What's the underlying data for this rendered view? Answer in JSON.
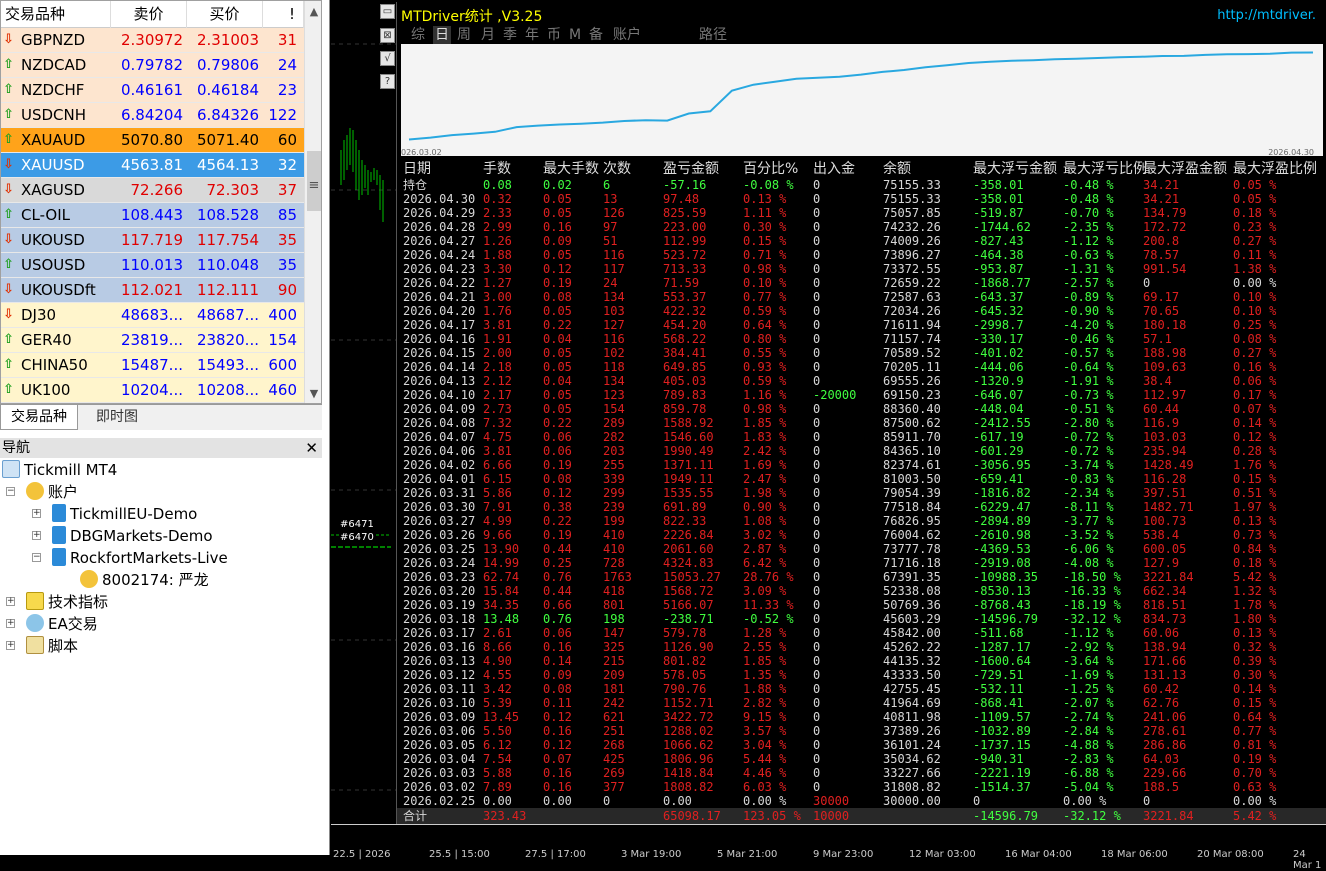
{
  "market_watch": {
    "headers": [
      "交易品种",
      "卖价",
      "买价",
      "!"
    ],
    "rows": [
      {
        "symbol": "GBPNZD",
        "bid": "2.30972",
        "ask": "2.31003",
        "spread": "31",
        "dir": "down",
        "bg": "#fde5cf",
        "color": "#e00000"
      },
      {
        "symbol": "NZDCAD",
        "bid": "0.79782",
        "ask": "0.79806",
        "spread": "24",
        "dir": "up",
        "bg": "#fde5cf",
        "color": "#0000ff"
      },
      {
        "symbol": "NZDCHF",
        "bid": "0.46161",
        "ask": "0.46184",
        "spread": "23",
        "dir": "up",
        "bg": "#fde5cf",
        "color": "#0000ff"
      },
      {
        "symbol": "USDCNH",
        "bid": "6.84204",
        "ask": "6.84326",
        "spread": "122",
        "dir": "up",
        "bg": "#fde5cf",
        "color": "#0000ff"
      },
      {
        "symbol": "XAUAUD",
        "bid": "5070.80",
        "ask": "5071.40",
        "spread": "60",
        "dir": "up",
        "bg": "#ffa31a",
        "color": "#000000"
      },
      {
        "symbol": "XAUUSD",
        "bid": "4563.81",
        "ask": "4564.13",
        "spread": "32",
        "dir": "down",
        "bg": "#3c9be6",
        "color": "#ffffff"
      },
      {
        "symbol": "XAGUSD",
        "bid": "72.266",
        "ask": "72.303",
        "spread": "37",
        "dir": "down",
        "bg": "#d9d9d9",
        "color": "#e00000"
      },
      {
        "symbol": "CL-OIL",
        "bid": "108.443",
        "ask": "108.528",
        "spread": "85",
        "dir": "up",
        "bg": "#b8cbe4",
        "color": "#0000ff"
      },
      {
        "symbol": "UKOUSD",
        "bid": "117.719",
        "ask": "117.754",
        "spread": "35",
        "dir": "down",
        "bg": "#b8cbe4",
        "color": "#e00000"
      },
      {
        "symbol": "USOUSD",
        "bid": "110.013",
        "ask": "110.048",
        "spread": "35",
        "dir": "up",
        "bg": "#b8cbe4",
        "color": "#0000ff"
      },
      {
        "symbol": "UKOUSDft",
        "bid": "112.021",
        "ask": "112.111",
        "spread": "90",
        "dir": "down",
        "bg": "#b8cbe4",
        "color": "#e00000"
      },
      {
        "symbol": "DJ30",
        "bid": "48683...",
        "ask": "48687...",
        "spread": "400",
        "dir": "down",
        "bg": "#fff5cc",
        "color": "#0000ff"
      },
      {
        "symbol": "GER40",
        "bid": "23819...",
        "ask": "23820...",
        "spread": "154",
        "dir": "up",
        "bg": "#fff5cc",
        "color": "#0000ff"
      },
      {
        "symbol": "CHINA50",
        "bid": "15487...",
        "ask": "15493...",
        "spread": "600",
        "dir": "up",
        "bg": "#fff5cc",
        "color": "#0000ff"
      },
      {
        "symbol": "UK100",
        "bid": "10204...",
        "ask": "10208...",
        "spread": "460",
        "dir": "up",
        "bg": "#fff5cc",
        "color": "#0000ff"
      }
    ],
    "tabs": [
      "交易品种",
      "即时图"
    ]
  },
  "navigator": {
    "title": "导航",
    "root": "Tickmill MT4",
    "accounts": "账户",
    "servers": [
      "TickmillEU-Demo",
      "DBGMarkets-Demo",
      "RockfortMarkets-Live"
    ],
    "login": "8002174: 严龙",
    "indicators": "技术指标",
    "ea": "EA交易",
    "scripts": "脚本"
  },
  "stats": {
    "title": "MTDriver统计 ,V3.25",
    "url": "http://mtdriver.",
    "tabs": [
      "综",
      "日",
      "周",
      "月",
      "季",
      "年",
      "币",
      "M",
      "备",
      "账户",
      "",
      "路径"
    ],
    "curve_start": "026.03.02",
    "curve_end": "2026.04.30",
    "headers": [
      "日期",
      "手数",
      "最大手数",
      "次数",
      "盈亏金额",
      "百分比%",
      "出入金",
      "余额",
      "最大浮亏金额",
      "最大浮亏比例",
      "最大浮盈金额",
      "最大浮盈比例"
    ],
    "rows": [
      [
        "持仓",
        "0.08",
        "0.02",
        "6",
        "-57.16",
        "-0.08 %",
        "0",
        "75155.33",
        "-358.01",
        "-0.48 %",
        "34.21",
        "0.05 %"
      ],
      [
        "2026.04.30",
        "0.32",
        "0.05",
        "13",
        "97.48",
        "0.13 %",
        "0",
        "75155.33",
        "-358.01",
        "-0.48 %",
        "34.21",
        "0.05 %"
      ],
      [
        "2026.04.29",
        "2.33",
        "0.05",
        "126",
        "825.59",
        "1.11 %",
        "0",
        "75057.85",
        "-519.87",
        "-0.70 %",
        "134.79",
        "0.18 %"
      ],
      [
        "2026.04.28",
        "2.99",
        "0.16",
        "97",
        "223.00",
        "0.30 %",
        "0",
        "74232.26",
        "-1744.62",
        "-2.35 %",
        "172.72",
        "0.23 %"
      ],
      [
        "2026.04.27",
        "1.26",
        "0.09",
        "51",
        "112.99",
        "0.15 %",
        "0",
        "74009.26",
        "-827.43",
        "-1.12 %",
        "200.8",
        "0.27 %"
      ],
      [
        "2026.04.24",
        "1.88",
        "0.05",
        "116",
        "523.72",
        "0.71 %",
        "0",
        "73896.27",
        "-464.38",
        "-0.63 %",
        "78.57",
        "0.11 %"
      ],
      [
        "2026.04.23",
        "3.30",
        "0.12",
        "117",
        "713.33",
        "0.98 %",
        "0",
        "73372.55",
        "-953.87",
        "-1.31 %",
        "991.54",
        "1.38 %"
      ],
      [
        "2026.04.22",
        "1.27",
        "0.19",
        "24",
        "71.59",
        "0.10 %",
        "0",
        "72659.22",
        "-1868.77",
        "-2.57 %",
        "0",
        "0.00 %"
      ],
      [
        "2026.04.21",
        "3.00",
        "0.08",
        "134",
        "553.37",
        "0.77 %",
        "0",
        "72587.63",
        "-643.37",
        "-0.89 %",
        "69.17",
        "0.10 %"
      ],
      [
        "2026.04.20",
        "1.76",
        "0.05",
        "103",
        "422.32",
        "0.59 %",
        "0",
        "72034.26",
        "-645.32",
        "-0.90 %",
        "70.65",
        "0.10 %"
      ],
      [
        "2026.04.17",
        "3.81",
        "0.22",
        "127",
        "454.20",
        "0.64 %",
        "0",
        "71611.94",
        "-2998.7",
        "-4.20 %",
        "180.18",
        "0.25 %"
      ],
      [
        "2026.04.16",
        "1.91",
        "0.04",
        "116",
        "568.22",
        "0.80 %",
        "0",
        "71157.74",
        "-330.17",
        "-0.46 %",
        "57.1",
        "0.08 %"
      ],
      [
        "2026.04.15",
        "2.00",
        "0.05",
        "102",
        "384.41",
        "0.55 %",
        "0",
        "70589.52",
        "-401.02",
        "-0.57 %",
        "188.98",
        "0.27 %"
      ],
      [
        "2026.04.14",
        "2.18",
        "0.05",
        "118",
        "649.85",
        "0.93 %",
        "0",
        "70205.11",
        "-444.06",
        "-0.64 %",
        "109.63",
        "0.16 %"
      ],
      [
        "2026.04.13",
        "2.12",
        "0.04",
        "134",
        "405.03",
        "0.59 %",
        "0",
        "69555.26",
        "-1320.9",
        "-1.91 %",
        "38.4",
        "0.06 %"
      ],
      [
        "2026.04.10",
        "2.17",
        "0.05",
        "123",
        "789.83",
        "1.16 %",
        "-20000",
        "69150.23",
        "-646.07",
        "-0.73 %",
        "112.97",
        "0.17 %"
      ],
      [
        "2026.04.09",
        "2.73",
        "0.05",
        "154",
        "859.78",
        "0.98 %",
        "0",
        "88360.40",
        "-448.04",
        "-0.51 %",
        "60.44",
        "0.07 %"
      ],
      [
        "2026.04.08",
        "7.32",
        "0.22",
        "289",
        "1588.92",
        "1.85 %",
        "0",
        "87500.62",
        "-2412.55",
        "-2.80 %",
        "116.9",
        "0.14 %"
      ],
      [
        "2026.04.07",
        "4.75",
        "0.06",
        "282",
        "1546.60",
        "1.83 %",
        "0",
        "85911.70",
        "-617.19",
        "-0.72 %",
        "103.03",
        "0.12 %"
      ],
      [
        "2026.04.06",
        "3.81",
        "0.06",
        "203",
        "1990.49",
        "2.42 %",
        "0",
        "84365.10",
        "-601.29",
        "-0.72 %",
        "235.94",
        "0.28 %"
      ],
      [
        "2026.04.02",
        "6.66",
        "0.19",
        "255",
        "1371.11",
        "1.69 %",
        "0",
        "82374.61",
        "-3056.95",
        "-3.74 %",
        "1428.49",
        "1.76 %"
      ],
      [
        "2026.04.01",
        "6.15",
        "0.08",
        "339",
        "1949.11",
        "2.47 %",
        "0",
        "81003.50",
        "-659.41",
        "-0.83 %",
        "116.28",
        "0.15 %"
      ],
      [
        "2026.03.31",
        "5.86",
        "0.12",
        "299",
        "1535.55",
        "1.98 %",
        "0",
        "79054.39",
        "-1816.82",
        "-2.34 %",
        "397.51",
        "0.51 %"
      ],
      [
        "2026.03.30",
        "7.91",
        "0.38",
        "239",
        "691.89",
        "0.90 %",
        "0",
        "77518.84",
        "-6229.47",
        "-8.11 %",
        "1482.71",
        "1.97 %"
      ],
      [
        "2026.03.27",
        "4.99",
        "0.22",
        "199",
        "822.33",
        "1.08 %",
        "0",
        "76826.95",
        "-2894.89",
        "-3.77 %",
        "100.73",
        "0.13 %"
      ],
      [
        "2026.03.26",
        "9.66",
        "0.19",
        "410",
        "2226.84",
        "3.02 %",
        "0",
        "76004.62",
        "-2610.98",
        "-3.52 %",
        "538.4",
        "0.73 %"
      ],
      [
        "2026.03.25",
        "13.90",
        "0.44",
        "410",
        "2061.60",
        "2.87 %",
        "0",
        "73777.78",
        "-4369.53",
        "-6.06 %",
        "600.05",
        "0.84 %"
      ],
      [
        "2026.03.24",
        "14.99",
        "0.25",
        "728",
        "4324.83",
        "6.42 %",
        "0",
        "71716.18",
        "-2919.08",
        "-4.08 %",
        "127.9",
        "0.18 %"
      ],
      [
        "2026.03.23",
        "62.74",
        "0.76",
        "1763",
        "15053.27",
        "28.76 %",
        "0",
        "67391.35",
        "-10988.35",
        "-18.50 %",
        "3221.84",
        "5.42 %"
      ],
      [
        "2026.03.20",
        "15.84",
        "0.44",
        "418",
        "1568.72",
        "3.09 %",
        "0",
        "52338.08",
        "-8530.13",
        "-16.33 %",
        "662.34",
        "1.32 %"
      ],
      [
        "2026.03.19",
        "34.35",
        "0.66",
        "801",
        "5166.07",
        "11.33 %",
        "0",
        "50769.36",
        "-8768.43",
        "-18.19 %",
        "818.51",
        "1.78 %"
      ],
      [
        "2026.03.18",
        "13.48",
        "0.76",
        "198",
        "-238.71",
        "-0.52 %",
        "0",
        "45603.29",
        "-14596.79",
        "-32.12 %",
        "834.73",
        "1.80 %"
      ],
      [
        "2026.03.17",
        "2.61",
        "0.06",
        "147",
        "579.78",
        "1.28 %",
        "0",
        "45842.00",
        "-511.68",
        "-1.12 %",
        "60.06",
        "0.13 %"
      ],
      [
        "2026.03.16",
        "8.66",
        "0.16",
        "325",
        "1126.90",
        "2.55 %",
        "0",
        "45262.22",
        "-1287.17",
        "-2.92 %",
        "138.94",
        "0.32 %"
      ],
      [
        "2026.03.13",
        "4.90",
        "0.14",
        "215",
        "801.82",
        "1.85 %",
        "0",
        "44135.32",
        "-1600.64",
        "-3.64 %",
        "171.66",
        "0.39 %"
      ],
      [
        "2026.03.12",
        "4.55",
        "0.09",
        "209",
        "578.05",
        "1.35 %",
        "0",
        "43333.50",
        "-729.51",
        "-1.69 %",
        "131.13",
        "0.30 %"
      ],
      [
        "2026.03.11",
        "3.42",
        "0.08",
        "181",
        "790.76",
        "1.88 %",
        "0",
        "42755.45",
        "-532.11",
        "-1.25 %",
        "60.42",
        "0.14 %"
      ],
      [
        "2026.03.10",
        "5.39",
        "0.11",
        "242",
        "1152.71",
        "2.82 %",
        "0",
        "41964.69",
        "-868.41",
        "-2.07 %",
        "62.76",
        "0.15 %"
      ],
      [
        "2026.03.09",
        "13.45",
        "0.12",
        "621",
        "3422.72",
        "9.15 %",
        "0",
        "40811.98",
        "-1109.57",
        "-2.74 %",
        "241.06",
        "0.64 %"
      ],
      [
        "2026.03.06",
        "5.50",
        "0.16",
        "251",
        "1288.02",
        "3.57 %",
        "0",
        "37389.26",
        "-1032.89",
        "-2.84 %",
        "278.61",
        "0.77 %"
      ],
      [
        "2026.03.05",
        "6.12",
        "0.12",
        "268",
        "1066.62",
        "3.04 %",
        "0",
        "36101.24",
        "-1737.15",
        "-4.88 %",
        "286.86",
        "0.81 %"
      ],
      [
        "2026.03.04",
        "7.54",
        "0.07",
        "425",
        "1806.96",
        "5.44 %",
        "0",
        "35034.62",
        "-940.31",
        "-2.83 %",
        "64.03",
        "0.19 %"
      ],
      [
        "2026.03.03",
        "5.88",
        "0.16",
        "269",
        "1418.84",
        "4.46 %",
        "0",
        "33227.66",
        "-2221.19",
        "-6.88 %",
        "229.66",
        "0.70 %"
      ],
      [
        "2026.03.02",
        "7.89",
        "0.16",
        "377",
        "1808.82",
        "6.03 %",
        "0",
        "31808.82",
        "-1514.37",
        "-5.04 %",
        "188.5",
        "0.63 %"
      ],
      [
        "2026.02.25",
        "0.00",
        "0.00",
        "0",
        "0.00",
        "0.00 %",
        "30000",
        "30000.00",
        "0",
        "0.00 %",
        "0",
        "0.00 %"
      ]
    ],
    "footer": {
      "label": "合计",
      "lots": "323.43",
      "pnl": "65098.17",
      "pct": "123.05 %",
      "deposit": "10000",
      "maxloss": "-14596.79",
      "maxlosspct": "-32.12 %",
      "maxprofit": "3221.84",
      "maxprofitpct": "5.42 %"
    },
    "chart_data": {
      "type": "line",
      "x": [
        "2026.03.02",
        "2026.03.03",
        "2026.03.04",
        "2026.03.05",
        "2026.03.06",
        "2026.03.09",
        "2026.03.10",
        "2026.03.11",
        "2026.03.12",
        "2026.03.13",
        "2026.03.16",
        "2026.03.17",
        "2026.03.18",
        "2026.03.19",
        "2026.03.20",
        "2026.03.23",
        "2026.03.24",
        "2026.03.25",
        "2026.03.26",
        "2026.03.27",
        "2026.03.30",
        "2026.03.31",
        "2026.04.01",
        "2026.04.02",
        "2026.04.06",
        "2026.04.07",
        "2026.04.08",
        "2026.04.09",
        "2026.04.10",
        "2026.04.13",
        "2026.04.14",
        "2026.04.15",
        "2026.04.16",
        "2026.04.17",
        "2026.04.20",
        "2026.04.21",
        "2026.04.22",
        "2026.04.23",
        "2026.04.24",
        "2026.04.27",
        "2026.04.28",
        "2026.04.29",
        "2026.04.30"
      ],
      "values": [
        1809,
        3228,
        5035,
        6101,
        7389,
        10812,
        11965,
        12755,
        13334,
        14135,
        15262,
        15842,
        15603,
        20769,
        22338,
        37391,
        41716,
        43778,
        46005,
        46827,
        47519,
        49054,
        51004,
        52375,
        54365,
        55912,
        57501,
        58361,
        59150,
        59555,
        60205,
        60590,
        61158,
        61612,
        62034,
        62588,
        62659,
        63373,
        63896,
        64009,
        64232,
        65058,
        65155
      ],
      "color": "#29a8e0"
    }
  },
  "chart_area": {
    "labels": [
      "#6471",
      "#6470"
    ],
    "time_ticks": [
      "22.5 | 2026",
      "25.5 | 15:00",
      "27.5 | 17:00",
      "3 Mar 19:00",
      "5 Mar 21:00",
      "9 Mar 23:00",
      "12 Mar 03:00",
      "16 Mar 04:00",
      "18 Mar 06:00",
      "20 Mar 08:00",
      "24 Mar 1"
    ]
  }
}
